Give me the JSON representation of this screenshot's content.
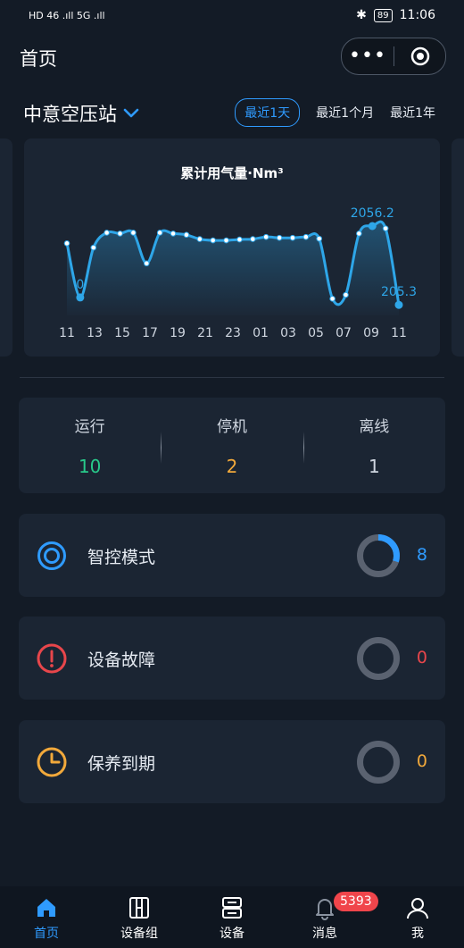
{
  "status_bar": {
    "left_icons": "HD 46 .ıll 5G .ıll",
    "time": "11:06",
    "battery": "89"
  },
  "header": {
    "title": "首页",
    "more": "•••"
  },
  "station": {
    "name": "中意空压站"
  },
  "ranges": [
    "最近1天",
    "最近1个月",
    "最近1年"
  ],
  "chart_data": {
    "type": "area",
    "title": "累计用气量·Nm³",
    "x_ticks": [
      "11",
      "13",
      "15",
      "17",
      "19",
      "21",
      "23",
      "01",
      "03",
      "05",
      "07",
      "09",
      "11"
    ],
    "values": [
      1650,
      380,
      1550,
      1900,
      1880,
      1900,
      1180,
      1900,
      1880,
      1850,
      1750,
      1720,
      1720,
      1740,
      1750,
      1800,
      1780,
      1780,
      1800,
      1760,
      350,
      440,
      1880,
      2056.2,
      2000,
      205.3
    ],
    "annotations": [
      {
        "label": "0",
        "index": 1
      },
      {
        "label": "2056.2",
        "index": 23
      },
      {
        "label": "205.3",
        "index": 25
      }
    ],
    "line_color": "#2ea6e8"
  },
  "status": {
    "running_label": "运行",
    "running_value": "10",
    "stopped_label": "停机",
    "stopped_value": "2",
    "offline_label": "离线",
    "offline_value": "1"
  },
  "features": [
    {
      "label": "智控模式",
      "count": "8",
      "color": "#2f9bff",
      "ring_fraction": 0.3,
      "icon": "target-icon"
    },
    {
      "label": "设备故障",
      "count": "0",
      "color": "#e8464b",
      "ring_fraction": 0,
      "icon": "alert-circle-icon"
    },
    {
      "label": "保养到期",
      "count": "0",
      "color": "#f2a93b",
      "ring_fraction": 0,
      "icon": "clock-icon"
    }
  ],
  "tabs": [
    {
      "label": "首页",
      "icon": "home-icon"
    },
    {
      "label": "设备组",
      "icon": "device-group-icon"
    },
    {
      "label": "设备",
      "icon": "device-icon"
    },
    {
      "label": "消息",
      "icon": "bell-icon",
      "badge": "5393"
    },
    {
      "label": "我",
      "icon": "user-icon"
    }
  ]
}
